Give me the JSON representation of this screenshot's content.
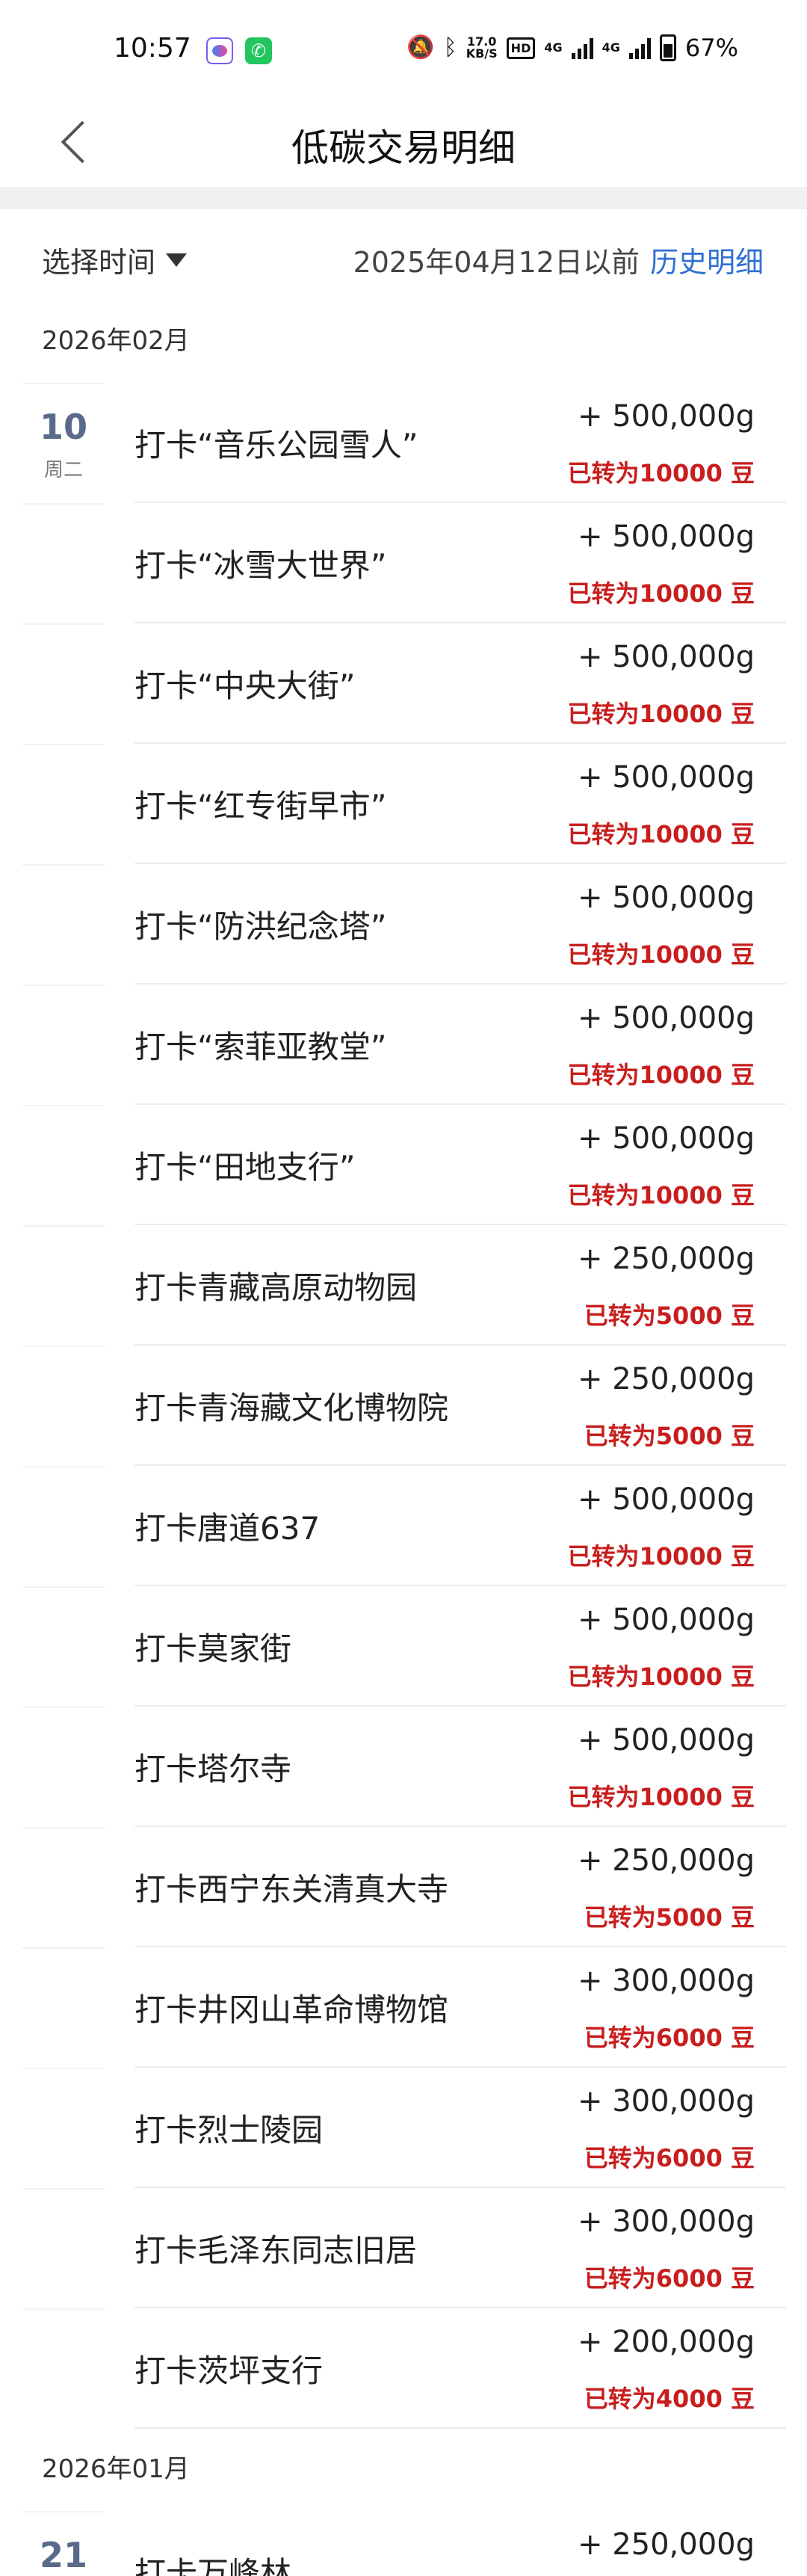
{
  "status": {
    "time": "10:57",
    "net_speed": "17.0\nKB/S",
    "hd": "HD",
    "signal1": "4G",
    "signal2": "4G",
    "battery": "67%"
  },
  "header": {
    "title": "低碳交易明细"
  },
  "filter": {
    "select_time": "选择时间",
    "before_text": "2025年04月12日以前",
    "history_link": "历史明细"
  },
  "groups": [
    {
      "month": "2026年02月",
      "day": "10",
      "weekday": "周二",
      "items": [
        {
          "title": "打卡“音乐公园雪人”",
          "amount": "+ 500,000g",
          "note": "已转为10000 豆"
        },
        {
          "title": "打卡“冰雪大世界”",
          "amount": "+ 500,000g",
          "note": "已转为10000 豆"
        },
        {
          "title": "打卡“中央大街”",
          "amount": "+ 500,000g",
          "note": "已转为10000 豆"
        },
        {
          "title": "打卡“红专街早市”",
          "amount": "+ 500,000g",
          "note": "已转为10000 豆"
        },
        {
          "title": "打卡“防洪纪念塔”",
          "amount": "+ 500,000g",
          "note": "已转为10000 豆"
        },
        {
          "title": "打卡“索菲亚教堂”",
          "amount": "+ 500,000g",
          "note": "已转为10000 豆"
        },
        {
          "title": "打卡“田地支行”",
          "amount": "+ 500,000g",
          "note": "已转为10000 豆"
        },
        {
          "title": "打卡青藏高原动物园",
          "amount": "+ 250,000g",
          "note": "已转为5000 豆"
        },
        {
          "title": "打卡青海藏文化博物院",
          "amount": "+ 250,000g",
          "note": "已转为5000 豆"
        },
        {
          "title": "打卡唐道637",
          "amount": "+ 500,000g",
          "note": "已转为10000 豆"
        },
        {
          "title": "打卡莫家街",
          "amount": "+ 500,000g",
          "note": "已转为10000 豆"
        },
        {
          "title": "打卡塔尔寺",
          "amount": "+ 500,000g",
          "note": "已转为10000 豆"
        },
        {
          "title": "打卡西宁东关清真大寺",
          "amount": "+ 250,000g",
          "note": "已转为5000 豆"
        },
        {
          "title": "打卡井冈山革命博物馆",
          "amount": "+ 300,000g",
          "note": "已转为6000 豆"
        },
        {
          "title": "打卡烈士陵园",
          "amount": "+ 300,000g",
          "note": "已转为6000 豆"
        },
        {
          "title": "打卡毛泽东同志旧居",
          "amount": "+ 300,000g",
          "note": "已转为6000 豆"
        },
        {
          "title": "打卡茨坪支行",
          "amount": "+ 200,000g",
          "note": "已转为4000 豆"
        }
      ]
    },
    {
      "month": "2026年01月",
      "day": "21",
      "weekday": "",
      "items": [
        {
          "title": "打卡万峰林",
          "amount": "+ 250,000g",
          "note": ""
        }
      ]
    }
  ]
}
